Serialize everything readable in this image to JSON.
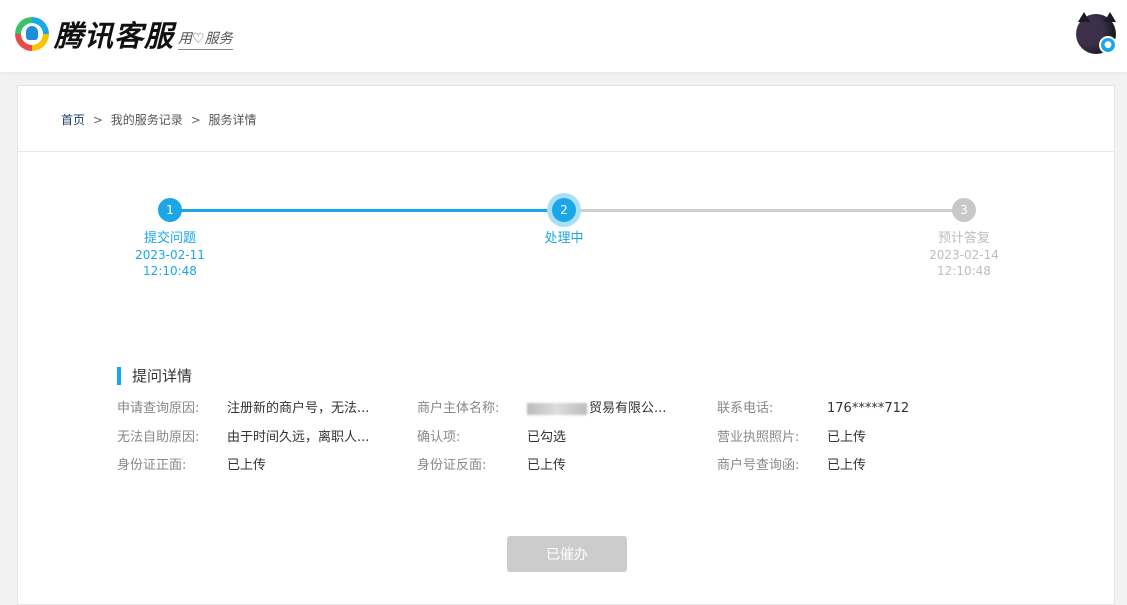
{
  "header": {
    "logo_text": "腾讯客服",
    "slogan": "用♡服务",
    "avatar_badge_icon": "qq-penguin-icon"
  },
  "breadcrumb": {
    "home": "首页",
    "sep1": ">",
    "records": "我的服务记录",
    "sep2": ">",
    "current": "服务详情"
  },
  "steps": [
    {
      "num": "1",
      "label": "提交问题",
      "date": "2023-02-11",
      "time": "12:10:48",
      "state": "done"
    },
    {
      "num": "2",
      "label": "处理中",
      "state": "active"
    },
    {
      "num": "3",
      "label": "预计答复",
      "date": "2023-02-14",
      "time": "12:10:48",
      "state": "todo"
    }
  ],
  "colors": {
    "accent": "#1aa6e8",
    "inactive": "#cfcfcf",
    "button_disabled": "#cccccc"
  },
  "details": {
    "title": "提问详情",
    "fields": [
      {
        "label": "申请查询原因:",
        "value": "注册新的商户号，无法..."
      },
      {
        "label": "商户主体名称:",
        "value": "贸易有限公..."
      },
      {
        "label": "联系电话:",
        "value": "176*****712"
      },
      {
        "label": "无法自助原因:",
        "value": "由于时间久远，离职人..."
      },
      {
        "label": "确认项:",
        "value": "已勾选"
      },
      {
        "label": "营业执照照片:",
        "value": "已上传"
      },
      {
        "label": "身份证正面:",
        "value": "已上传"
      },
      {
        "label": "身份证反面:",
        "value": "已上传"
      },
      {
        "label": "商户号查询函:",
        "value": "已上传"
      }
    ]
  },
  "button": {
    "label": "已催办"
  }
}
